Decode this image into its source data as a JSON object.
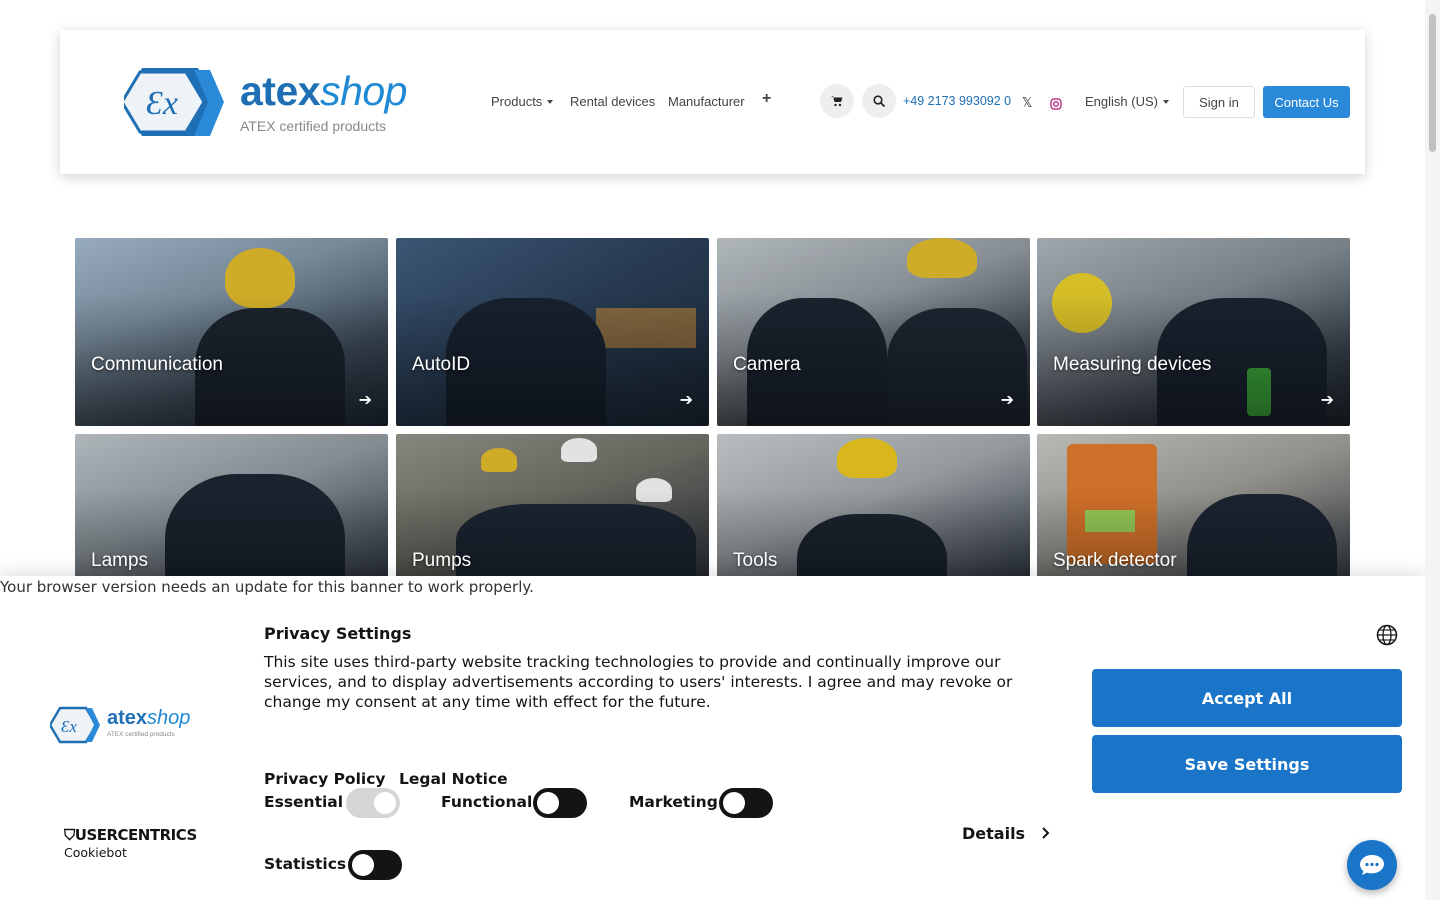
{
  "header": {
    "logo": {
      "word_main": "atex",
      "word_italic": "shop",
      "tagline": "ATEX certified products"
    },
    "nav": [
      {
        "label": "Products",
        "dropdown": true
      },
      {
        "label": "Rental devices",
        "dropdown": false
      },
      {
        "label": "Manufacturer",
        "dropdown": false
      },
      {
        "label": "+",
        "dropdown": false
      }
    ],
    "phone": "+49 2173 993092 0",
    "language": "English (US)",
    "sign_in": "Sign in",
    "contact": "Contact Us",
    "icons": [
      "cart-icon",
      "search-icon",
      "x-twitter-icon",
      "instagram-icon"
    ]
  },
  "categories": [
    {
      "label": "Communication",
      "arrow": "➔"
    },
    {
      "label": "AutoID",
      "arrow": "➔"
    },
    {
      "label": "Camera",
      "arrow": "➔"
    },
    {
      "label": "Measuring devices",
      "arrow": "➔"
    },
    {
      "label": "Lamps"
    },
    {
      "label": "Pumps"
    },
    {
      "label": "Tools"
    },
    {
      "label": "Spark detector"
    }
  ],
  "banner": {
    "browser_notice": "Your browser version needs an update for this banner to work properly.",
    "title": "Privacy Settings",
    "text": "This site uses third-party website tracking technologies to provide and continually improve our services, and to display advertisements according to users' interests. I agree and may revoke or change my consent at any time with effect for the future.",
    "privacy_policy": "Privacy Policy",
    "legal_notice": "Legal Notice",
    "toggles": [
      {
        "label": "Essential",
        "on": true
      },
      {
        "label": "Functional",
        "on": false
      },
      {
        "label": "Marketing",
        "on": false
      },
      {
        "label": "Statistics",
        "on": false
      }
    ],
    "details": "Details",
    "accept_all": "Accept All",
    "save_settings": "Save Settings",
    "logo": {
      "word_main": "atex",
      "word_italic": "shop",
      "tagline": "ATEX certified products"
    },
    "usercentrics": "USERCENTRICS",
    "cookiebot": "Cookiebot"
  },
  "colors": {
    "brand_blue": "#1f6fb5",
    "button_blue": "#1a75c8",
    "contact_blue": "#2a8ad9"
  }
}
